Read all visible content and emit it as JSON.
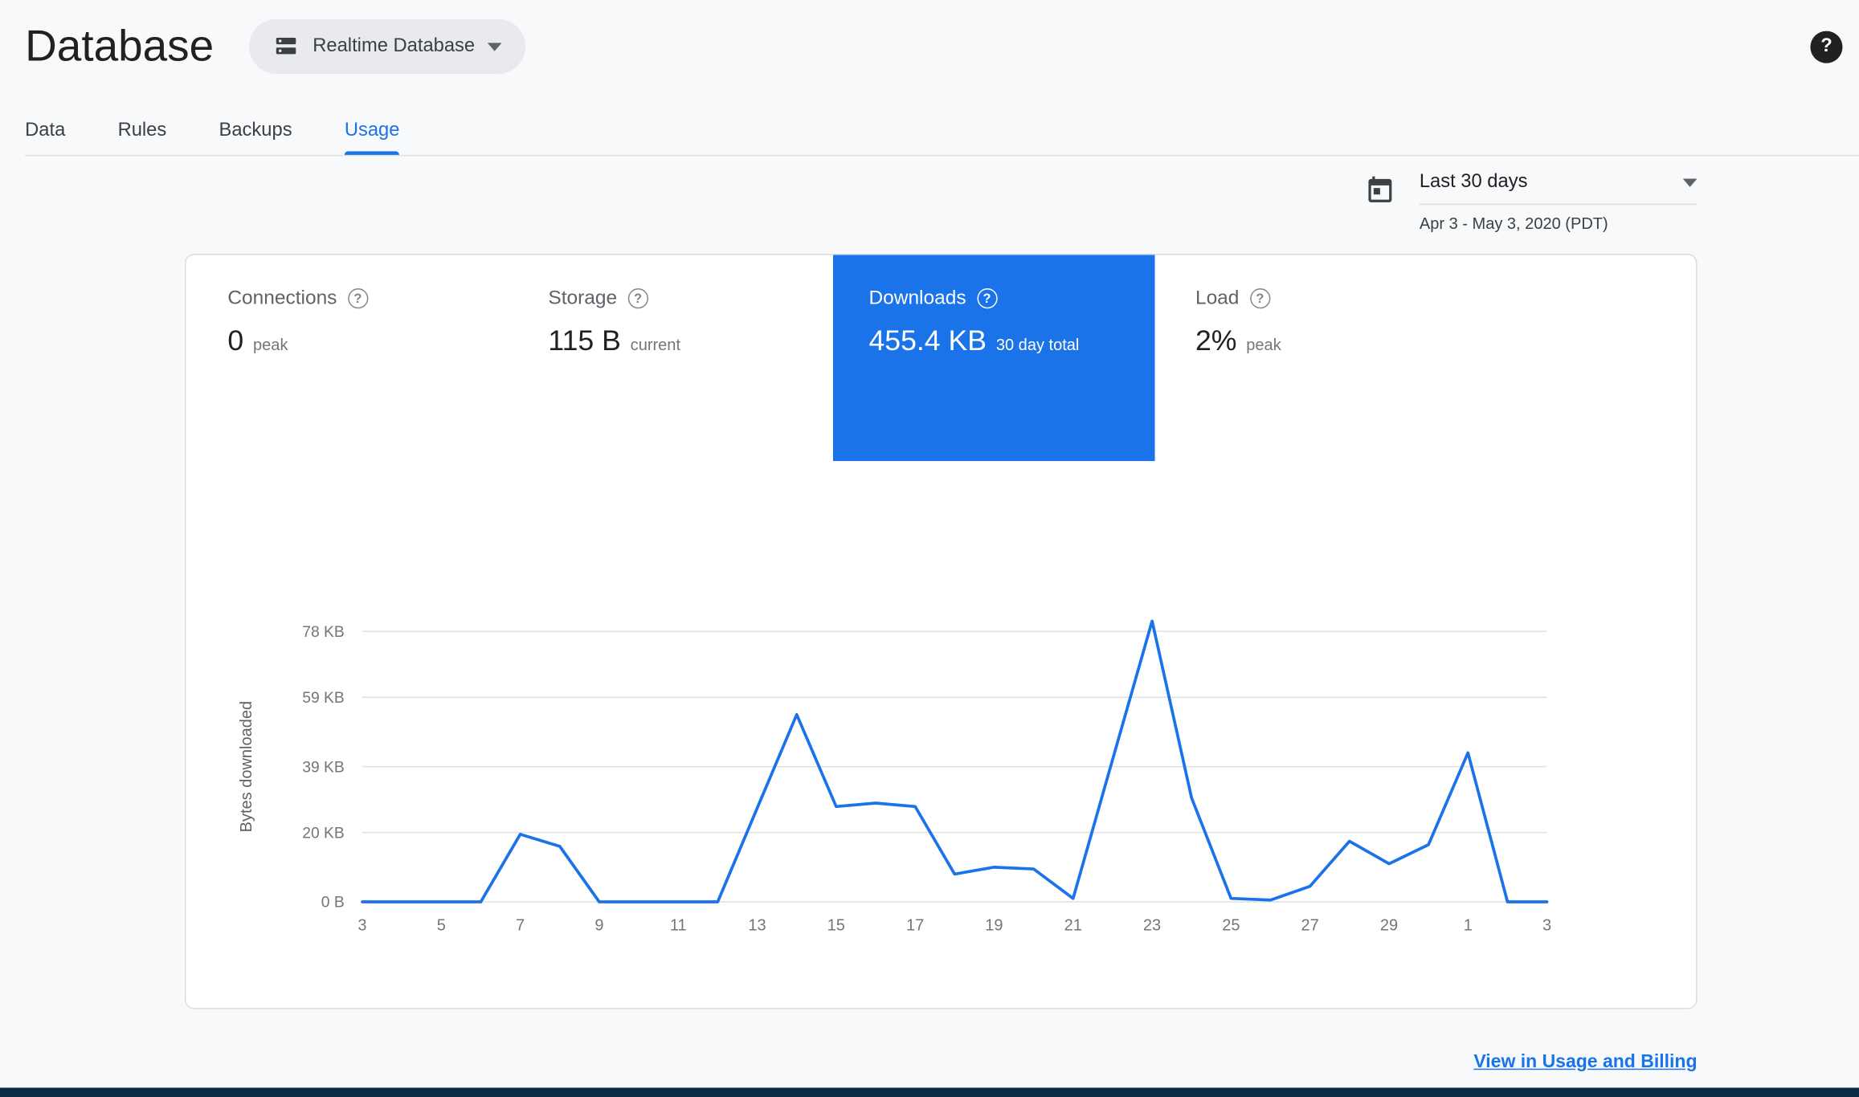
{
  "header": {
    "title": "Database",
    "db_selector_label": "Realtime Database"
  },
  "icons": {
    "question_mark": "?"
  },
  "tabs": [
    {
      "label": "Data"
    },
    {
      "label": "Rules"
    },
    {
      "label": "Backups"
    },
    {
      "label": "Usage"
    }
  ],
  "date_range": {
    "preset": "Last 30 days",
    "range": "Apr 3 - May 3, 2020 (PDT)"
  },
  "metrics": [
    {
      "label": "Connections",
      "value": "0",
      "caption": "peak"
    },
    {
      "label": "Storage",
      "value": "115 B",
      "caption": "current"
    },
    {
      "label": "Downloads",
      "value": "455.4 KB",
      "caption": "30 day total"
    },
    {
      "label": "Load",
      "value": "2%",
      "caption": "peak"
    }
  ],
  "chart_data": {
    "type": "line",
    "title": "",
    "xlabel": "",
    "ylabel": "Bytes downloaded",
    "units": "KB",
    "x": [
      3,
      4,
      5,
      6,
      7,
      8,
      9,
      10,
      11,
      12,
      13,
      14,
      15,
      16,
      17,
      18,
      19,
      20,
      21,
      22,
      23,
      24,
      25,
      26,
      27,
      28,
      29,
      30,
      1,
      2,
      3
    ],
    "values_kb": [
      0,
      0,
      0,
      0,
      19.5,
      16,
      0,
      0,
      0,
      0,
      27,
      54,
      27.5,
      28.5,
      27.5,
      8,
      10,
      9.5,
      1,
      41,
      81,
      30,
      1,
      0.5,
      4.5,
      17.5,
      11,
      16.5,
      43,
      0,
      0
    ],
    "yticks": [
      {
        "value": 0,
        "label": "0 B"
      },
      {
        "value": 20,
        "label": "20 KB"
      },
      {
        "value": 39,
        "label": "39 KB"
      },
      {
        "value": 59,
        "label": "59 KB"
      },
      {
        "value": 78,
        "label": "78 KB"
      }
    ],
    "xtick_labels": [
      "3",
      "5",
      "7",
      "9",
      "11",
      "13",
      "15",
      "17",
      "19",
      "21",
      "23",
      "25",
      "27",
      "29",
      "1",
      "3"
    ],
    "ylim": [
      0,
      84
    ],
    "grid": true,
    "legend": "none",
    "series_color": "#1a73e8"
  },
  "footer": {
    "link_label": "View in Usage and Billing"
  },
  "colors": {
    "accent": "#1a73e8",
    "selected_metric_bg": "#1a73e8",
    "bottom_bar": "#0c2c46"
  }
}
